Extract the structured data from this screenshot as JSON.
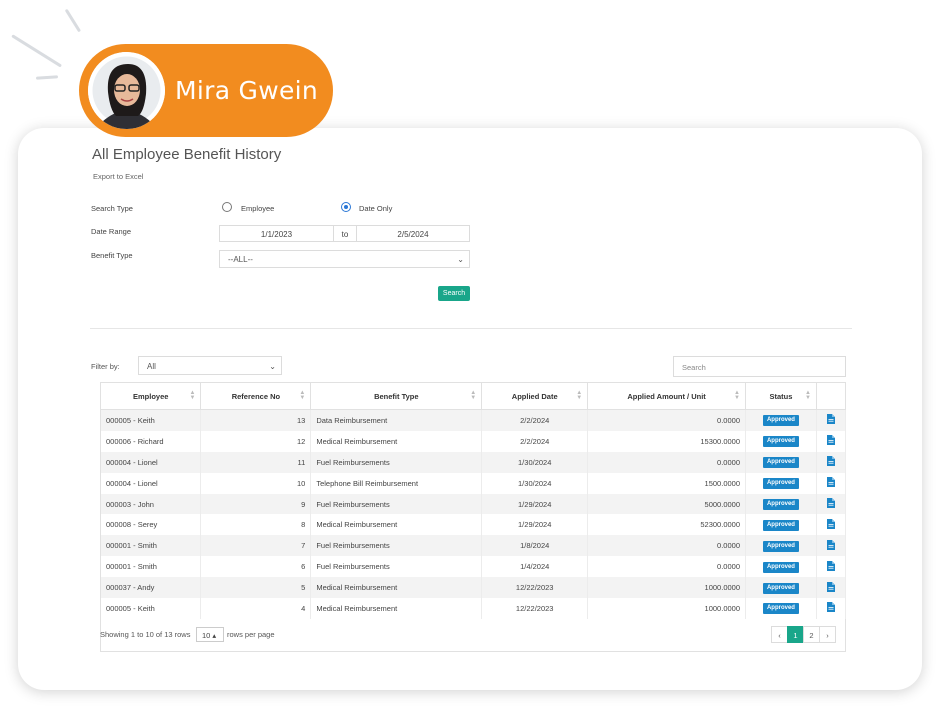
{
  "user": {
    "name": "Mira Gwein"
  },
  "page": {
    "title": "All Employee Benefit History",
    "export_label": "Export to Excel"
  },
  "form": {
    "search_type_label": "Search Type",
    "search_type_options": [
      "Employee",
      "Date Only"
    ],
    "search_type_selected": "Date Only",
    "date_range_label": "Date Range",
    "date_from": "1/1/2023",
    "to_label": "to",
    "date_to": "2/5/2024",
    "benefit_type_label": "Benefit Type",
    "benefit_type_value": "--ALL--",
    "search_button": "Search"
  },
  "filter": {
    "label": "Filter by:",
    "value": "All",
    "search_placeholder": "Search"
  },
  "table": {
    "columns": [
      "Employee",
      "Reference No",
      "Benefit Type",
      "Applied Date",
      "Applied Amount / Unit",
      "Status"
    ],
    "rows": [
      [
        "000005 - Keith",
        "13",
        "Data Reimbursement",
        "2/2/2024",
        "0.0000",
        "Approved"
      ],
      [
        "000006 - Richard",
        "12",
        "Medical Reimbursement",
        "2/2/2024",
        "15300.0000",
        "Approved"
      ],
      [
        "000004 - Lionel",
        "11",
        "Fuel Reimbursements",
        "1/30/2024",
        "0.0000",
        "Approved"
      ],
      [
        "000004 - Lionel",
        "10",
        "Telephone Bill Reimbursement",
        "1/30/2024",
        "1500.0000",
        "Approved"
      ],
      [
        "000003 - John",
        "9",
        "Fuel Reimbursements",
        "1/29/2024",
        "5000.0000",
        "Approved"
      ],
      [
        "000008 - Serey",
        "8",
        "Medical Reimbursement",
        "1/29/2024",
        "52300.0000",
        "Approved"
      ],
      [
        "000001 - Smith",
        "7",
        "Fuel Reimbursements",
        "1/8/2024",
        "0.0000",
        "Approved"
      ],
      [
        "000001 - Smith",
        "6",
        "Fuel Reimbursements",
        "1/4/2024",
        "0.0000",
        "Approved"
      ],
      [
        "000037 - Andy",
        "5",
        "Medical Reimbursement",
        "12/22/2023",
        "1000.0000",
        "Approved"
      ],
      [
        "000005 - Keith",
        "4",
        "Medical Reimbursement",
        "12/22/2023",
        "1000.0000",
        "Approved"
      ]
    ],
    "row_icon": "document-icon"
  },
  "footer": {
    "showing_text": "Showing 1 to 10 of 13 rows",
    "rows_per_page": "10 ▴",
    "rows_per_page_label": "rows per page",
    "pages": [
      "‹",
      "1",
      "2",
      "›"
    ],
    "active_page": "1"
  },
  "colors": {
    "brand_orange": "#f28c1f",
    "accent_green": "#19a68a",
    "status_blue": "#1a86c8"
  }
}
